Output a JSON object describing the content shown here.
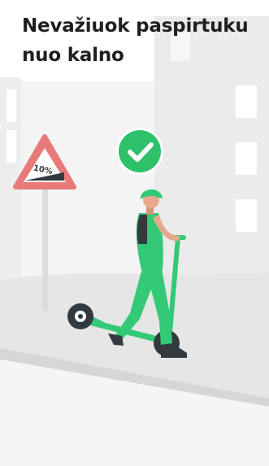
{
  "screen": {
    "title": "Nevažiuok paspirtuku nuo kalno"
  },
  "illustration": {
    "sign_text": "10%",
    "colors": {
      "sky": "#f4f4f4",
      "building": "#ebebeb",
      "hill": "#e4e4e4",
      "road_edge": "#d3d3d3",
      "sign_red": "#e87a7a",
      "check_green": "#2fc16a",
      "scooter_green": "#33c976",
      "dark": "#333a3f"
    }
  }
}
